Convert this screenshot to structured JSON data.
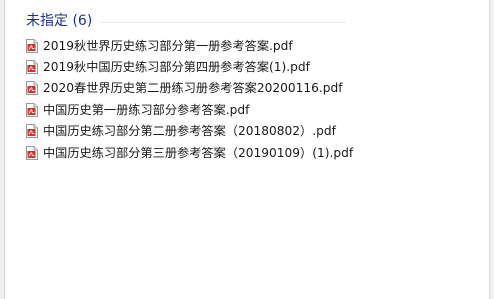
{
  "group": {
    "title": "未指定 (6)"
  },
  "files": [
    {
      "name": "2019秋世界历史练习部分第一册参考答案.pdf",
      "icon": "pdf-file-icon"
    },
    {
      "name": "2019秋中国历史练习部分第四册参考答案(1).pdf",
      "icon": "pdf-file-icon"
    },
    {
      "name": "2020春世界历史第二册练习册参考答案20200116.pdf",
      "icon": "pdf-file-icon"
    },
    {
      "name": "中国历史第一册练习部分参考答案.pdf",
      "icon": "pdf-file-icon"
    },
    {
      "name": "中国历史练习部分第二册参考答案（20180802）.pdf",
      "icon": "pdf-file-icon"
    },
    {
      "name": "中国历史练习部分第三册参考答案（20190109）(1).pdf",
      "icon": "pdf-file-icon"
    }
  ],
  "colors": {
    "group_title": "#1e3287",
    "pdf_red": "#d42a2a"
  }
}
